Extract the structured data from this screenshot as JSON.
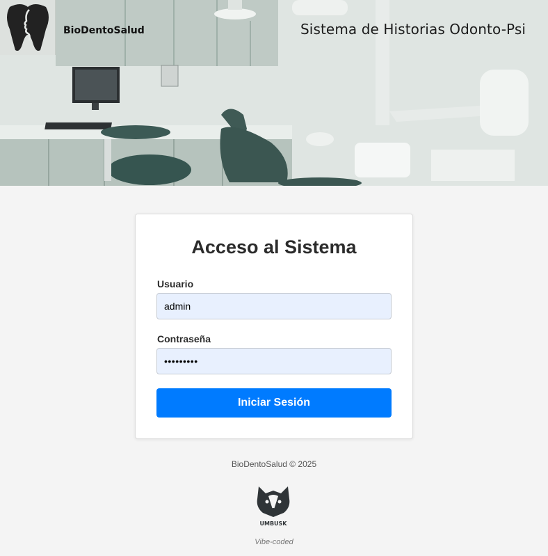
{
  "header": {
    "brand_name": "BioDentoSalud",
    "system_title": "Sistema de Historias Odonto-Psi"
  },
  "login": {
    "title": "Acceso al Sistema",
    "username_label": "Usuario",
    "username_value": "admin",
    "password_label": "Contraseña",
    "password_masked": "•••••••••",
    "submit_label": "Iniciar Sesión"
  },
  "footer": {
    "copyright": "BioDentoSalud © 2025",
    "maker_logo_text": "UMBUSK",
    "tagline": "Vibe-coded"
  },
  "colors": {
    "primary_button": "#007bff",
    "input_background": "#e8f0fe",
    "page_background": "#f4f4f4"
  }
}
